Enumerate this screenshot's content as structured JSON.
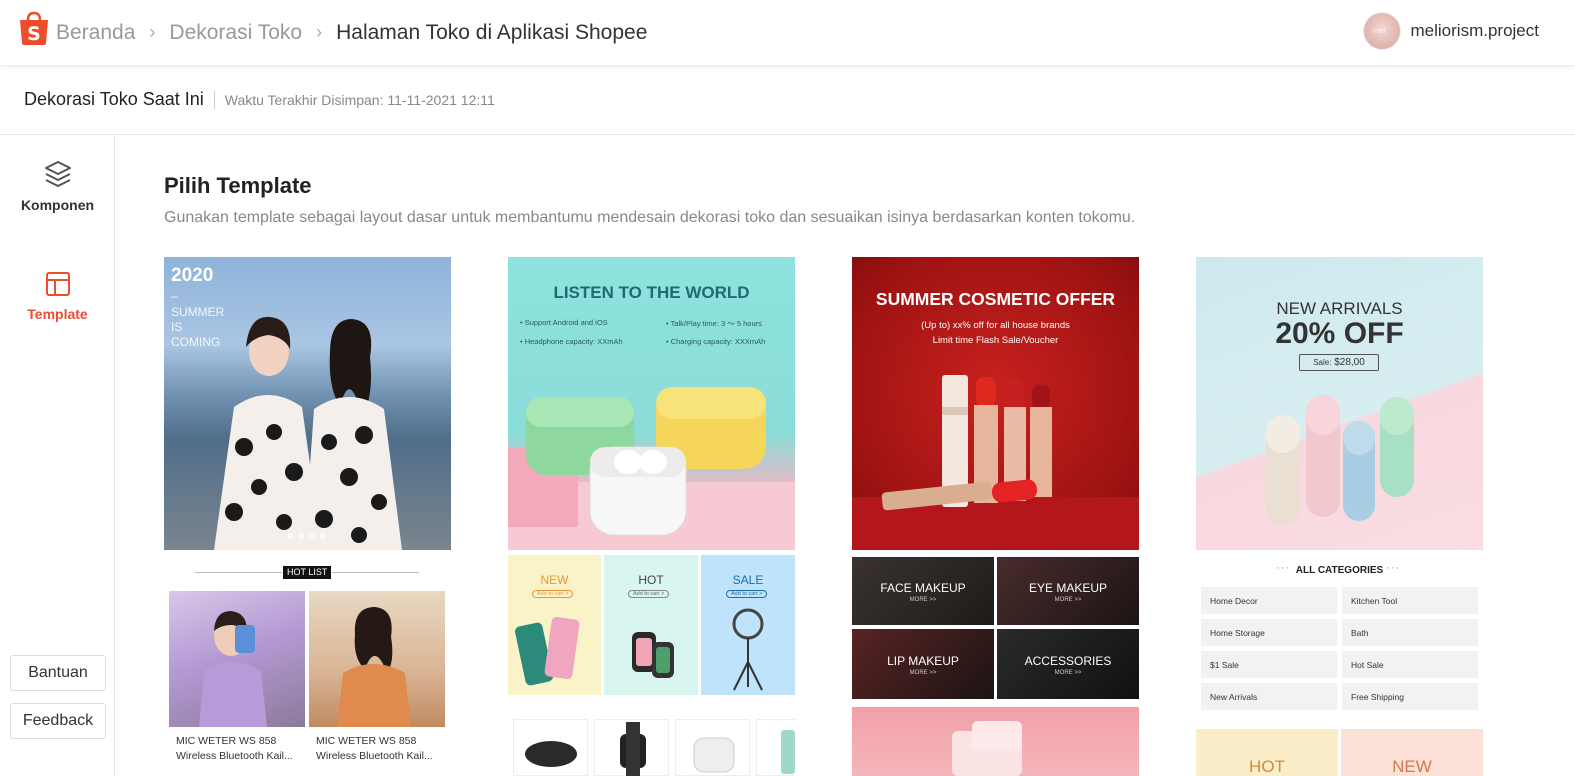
{
  "header": {
    "breadcrumbs": [
      "Beranda",
      "Dekorasi Toko",
      "Halaman Toko di Aplikasi Shopee"
    ],
    "username": "meliorism.project"
  },
  "subbar": {
    "title": "Dekorasi Toko Saat Ini",
    "saved_time": "Waktu Terakhir Disimpan: 11-11-2021 12:11"
  },
  "sidebar": {
    "items": [
      {
        "label": "Komponen",
        "icon": "layers-icon"
      },
      {
        "label": "Template",
        "icon": "template-layout-icon"
      }
    ],
    "help_label": "Bantuan",
    "feedback_label": "Feedback"
  },
  "main": {
    "title": "Pilih Template",
    "description": "Gunakan template sebagai layout dasar untuk membantumu mendesain dekorasi toko dan sesuaikan isinya berdasarkan konten tokomu."
  },
  "templates": [
    {
      "hero_year": "2020",
      "hero_dash": "–",
      "hero_lines": [
        "SUMMER",
        "IS",
        "COMING"
      ],
      "section_tag": "HOT LIST",
      "products": [
        {
          "line1": "MIC WETER WS 858",
          "line2": "Wireless Bluetooth Kail..."
        },
        {
          "line1": "MIC WETER WS 858",
          "line2": "Wireless Bluetooth Kail..."
        }
      ]
    },
    {
      "hero_title": "LISTEN TO THE WORLD",
      "features": [
        "• Support Android and iOS",
        "• Talk/Play time: 3 ～ 5 hours",
        "• Headphone capacity: XXmAh",
        "• Charging capacity: XXXmAh"
      ],
      "tiles": [
        {
          "label": "NEW",
          "sub": "Add to cart >"
        },
        {
          "label": "HOT",
          "sub": "Add to cart >"
        },
        {
          "label": "SALE",
          "sub": "Add to cart >"
        }
      ]
    },
    {
      "hero_title": "SUMMER COSMETIC OFFER",
      "hero_sub1": "(Up to) xx% off for all house brands",
      "hero_sub2": "Limit time Flash Sale/Voucher",
      "tiles": [
        {
          "label": "FACE MAKEUP",
          "more": "MORE >>"
        },
        {
          "label": "EYE MAKEUP",
          "more": "MORE >>"
        },
        {
          "label": "LIP MAKEUP",
          "more": "MORE >>"
        },
        {
          "label": "ACCESSORIES",
          "more": "MORE >>"
        }
      ]
    },
    {
      "hero_line1": "NEW ARRIVALS",
      "hero_line2": "20% OFF",
      "price_tag_prefix": "Sale:",
      "price_tag_value": "$28,00",
      "categories_title": "ALL CATEGORIES",
      "categories": [
        "Home Decor",
        "Kitchen Tool",
        "Home Storage",
        "Bath",
        "$1 Sale",
        "Hot Sale",
        "New Arrivals",
        "Free Shipping"
      ],
      "bottom_labels": [
        "HOT",
        "NEW"
      ]
    }
  ],
  "colors": {
    "brand": "#ee4d2d",
    "text_primary": "#333333",
    "text_secondary": "#888888"
  }
}
